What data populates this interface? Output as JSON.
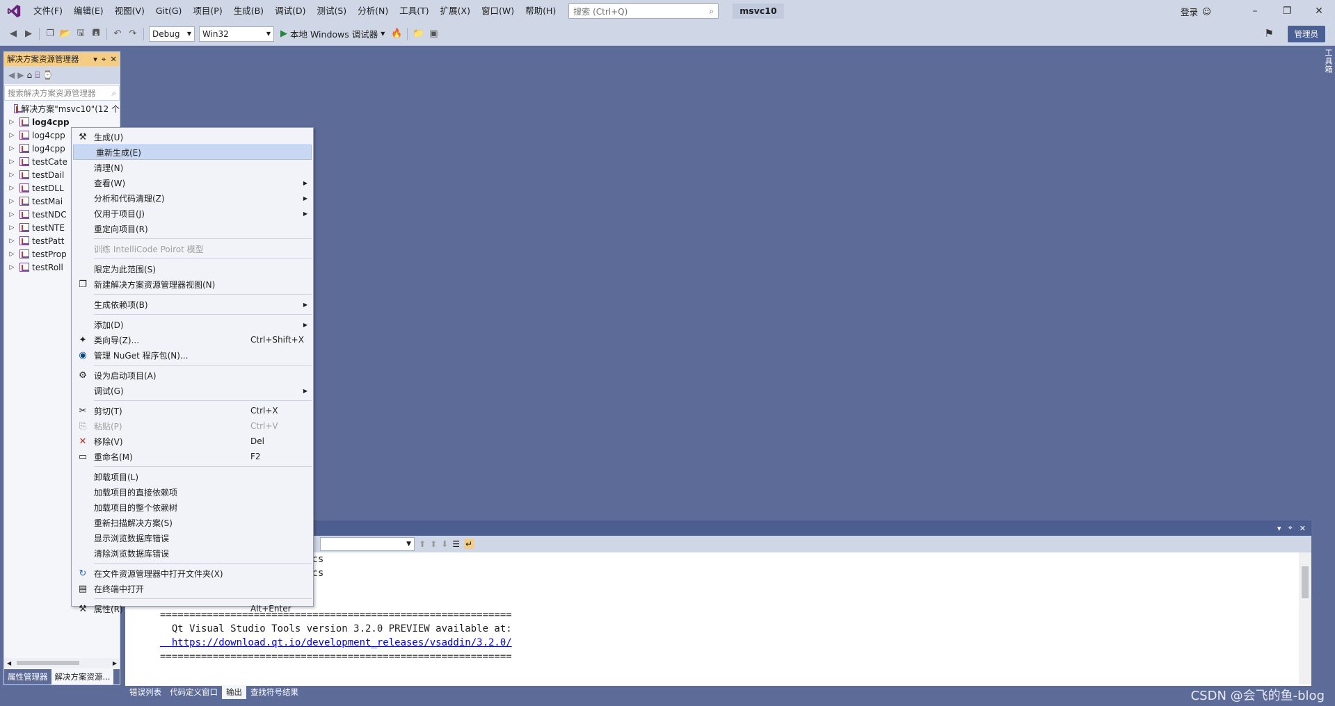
{
  "menubar": {
    "items": [
      "文件(F)",
      "编辑(E)",
      "视图(V)",
      "Git(G)",
      "项目(P)",
      "生成(B)",
      "调试(D)",
      "测试(S)",
      "分析(N)",
      "工具(T)",
      "扩展(X)",
      "窗口(W)",
      "帮助(H)"
    ],
    "search_placeholder": "搜索 (Ctrl+Q)",
    "solution_name": "msvc10",
    "login": "登录"
  },
  "toolbar": {
    "configuration": "Debug",
    "platform": "Win32",
    "debugger": "本地 Windows 调试器",
    "admin_badge": "管理员"
  },
  "solution_explorer": {
    "title": "解决方案资源管理器",
    "search_placeholder": "搜索解决方案资源管理器",
    "solution_node": "解决方案\"msvc10\"(12 个",
    "projects": [
      "log4cpp",
      "log4cpp",
      "log4cpp",
      "testCate",
      "testDail",
      "testDLL",
      "testMai",
      "testNDC",
      "testNTE",
      "testPatt",
      "testProp",
      "testRoll"
    ],
    "tabs": [
      "属性管理器",
      "解决方案资源..."
    ]
  },
  "toolbox_strip": "工具箱",
  "context_menu": {
    "items": [
      {
        "label": "生成(U)",
        "shortcut": "",
        "icon": "build-icon"
      },
      {
        "label": "重新生成(E)",
        "shortcut": "",
        "icon": ""
      },
      {
        "label": "清理(N)",
        "shortcut": "",
        "icon": ""
      },
      {
        "label": "查看(W)",
        "shortcut": "",
        "icon": ""
      },
      {
        "label": "分析和代码清理(Z)",
        "shortcut": "",
        "icon": ""
      },
      {
        "label": "仅用于项目(J)",
        "shortcut": "",
        "icon": ""
      },
      {
        "label": "重定向项目(R)",
        "shortcut": "",
        "icon": ""
      },
      {
        "label": "训练 IntelliCode Poirot 模型",
        "shortcut": "",
        "icon": ""
      },
      {
        "label": "限定为此范围(S)",
        "shortcut": "",
        "icon": ""
      },
      {
        "label": "新建解决方案资源管理器视图(N)",
        "shortcut": "",
        "icon": "new-view-icon"
      },
      {
        "label": "生成依赖项(B)",
        "shortcut": "",
        "icon": ""
      },
      {
        "label": "添加(D)",
        "shortcut": "",
        "icon": ""
      },
      {
        "label": "类向导(Z)...",
        "shortcut": "Ctrl+Shift+X",
        "icon": "class-wizard-icon"
      },
      {
        "label": "管理 NuGet 程序包(N)...",
        "shortcut": "",
        "icon": "nuget-icon"
      },
      {
        "label": "设为启动项目(A)",
        "shortcut": "",
        "icon": "gear-icon"
      },
      {
        "label": "调试(G)",
        "shortcut": "",
        "icon": ""
      },
      {
        "label": "剪切(T)",
        "shortcut": "Ctrl+X",
        "icon": "cut-icon"
      },
      {
        "label": "粘贴(P)",
        "shortcut": "Ctrl+V",
        "icon": "paste-icon"
      },
      {
        "label": "移除(V)",
        "shortcut": "Del",
        "icon": "remove-icon"
      },
      {
        "label": "重命名(M)",
        "shortcut": "F2",
        "icon": "rename-icon"
      },
      {
        "label": "卸载项目(L)",
        "shortcut": "",
        "icon": ""
      },
      {
        "label": "加载项目的直接依赖项",
        "shortcut": "",
        "icon": ""
      },
      {
        "label": "加载项目的整个依赖树",
        "shortcut": "",
        "icon": ""
      },
      {
        "label": "重新扫描解决方案(S)",
        "shortcut": "",
        "icon": ""
      },
      {
        "label": "显示浏览数据库错误",
        "shortcut": "",
        "icon": ""
      },
      {
        "label": "清除浏览数据库错误",
        "shortcut": "",
        "icon": ""
      },
      {
        "label": "在文件资源管理器中打开文件夹(X)",
        "shortcut": "",
        "icon": "open-folder-icon"
      },
      {
        "label": "在终端中打开",
        "shortcut": "",
        "icon": "terminal-icon"
      },
      {
        "label": "属性(R)",
        "shortcut": "Alt+Enter",
        "icon": "wrench-icon"
      }
    ]
  },
  "output": {
    "lines": [
      "ecs",
      "ecs",
      "",
      "",
      "============================================================",
      "  Qt Visual Studio Tools version 3.2.0 PREVIEW available at:",
      "  https://download.qt.io/development_releases/vsaddin/3.2.0/",
      "============================================================"
    ],
    "tabs": [
      "错误列表",
      "代码定义窗口",
      "输出",
      "查找符号结果"
    ]
  },
  "watermark": "CSDN @会飞的鱼-blog"
}
